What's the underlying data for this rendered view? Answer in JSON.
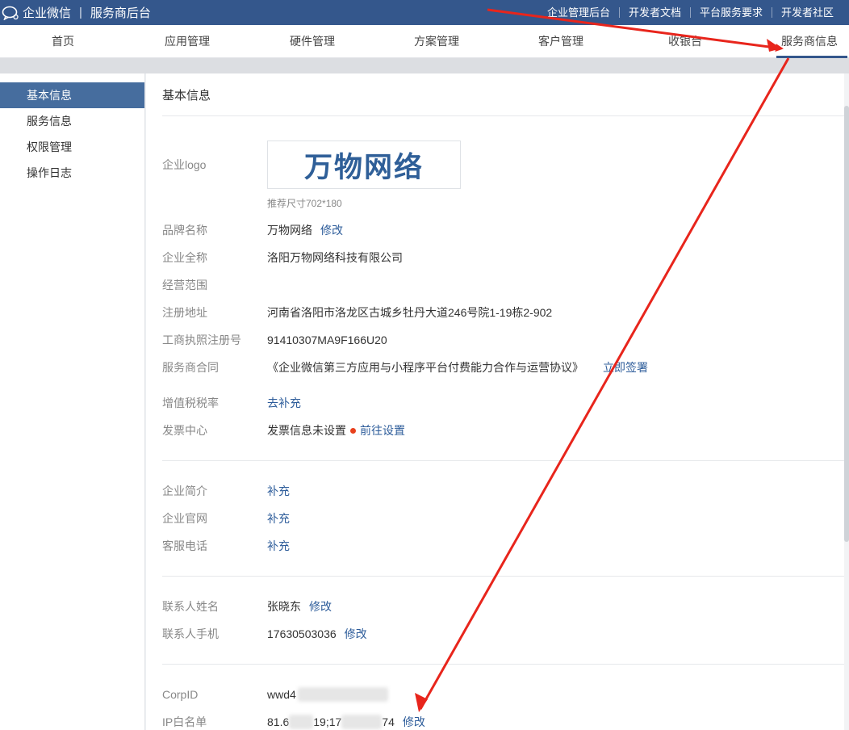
{
  "app": {
    "name": "企业微信",
    "section": "服务商后台",
    "separator": "|"
  },
  "top_links": [
    "企业管理后台",
    "开发者文档",
    "平台服务要求",
    "开发者社区"
  ],
  "nav": {
    "tabs": [
      "首页",
      "应用管理",
      "硬件管理",
      "方案管理",
      "客户管理",
      "收银台",
      "服务商信息"
    ],
    "active": "服务商信息"
  },
  "sidebar": {
    "items": [
      "基本信息",
      "服务信息",
      "权限管理",
      "操作日志"
    ],
    "active": "基本信息"
  },
  "main": {
    "title": "基本信息",
    "logo": {
      "label": "企业logo",
      "text": "万物网络",
      "hint": "推荐尺寸702*180"
    },
    "brand_name": {
      "label": "品牌名称",
      "value": "万物网络",
      "action": "修改"
    },
    "full_name": {
      "label": "企业全称",
      "value": "洛阳万物网络科技有限公司"
    },
    "business_scope": {
      "label": "经营范围",
      "value": ""
    },
    "address": {
      "label": "注册地址",
      "value": "河南省洛阳市洛龙区古城乡牡丹大道246号院1-19栋2-902"
    },
    "license_no": {
      "label": "工商执照注册号",
      "value": "91410307MA9F166U20"
    },
    "contract": {
      "label": "服务商合同",
      "value": "《企业微信第三方应用与小程序平台付费能力合作与运营协议》",
      "action": "立即签署"
    },
    "vat": {
      "label": "增值税税率",
      "action": "去补充"
    },
    "invoice": {
      "label": "发票中心",
      "value": "发票信息未设置",
      "action": "前往设置"
    },
    "intro": {
      "label": "企业简介",
      "action": "补充"
    },
    "website": {
      "label": "企业官网",
      "action": "补充"
    },
    "service_phone": {
      "label": "客服电话",
      "action": "补充"
    },
    "contact_name": {
      "label": "联系人姓名",
      "value": "张晓东",
      "action": "修改"
    },
    "contact_phone": {
      "label": "联系人手机",
      "value": "17630503036",
      "action": "修改"
    },
    "corpid": {
      "label": "CorpID",
      "value_visible": "wwd4"
    },
    "ip_whitelist": {
      "label": "IP白名单",
      "value_part1": "81.6",
      "value_part2": "19;17",
      "value_part3": "74",
      "action": "修改"
    }
  },
  "colors": {
    "topbar": "#34578c",
    "link": "#2d5c9a",
    "sidebar_active": "#466d9e",
    "arrow": "#e8251c",
    "status_dot": "#e8401c"
  },
  "icons": {
    "brand": "chat-bubble-icon"
  }
}
